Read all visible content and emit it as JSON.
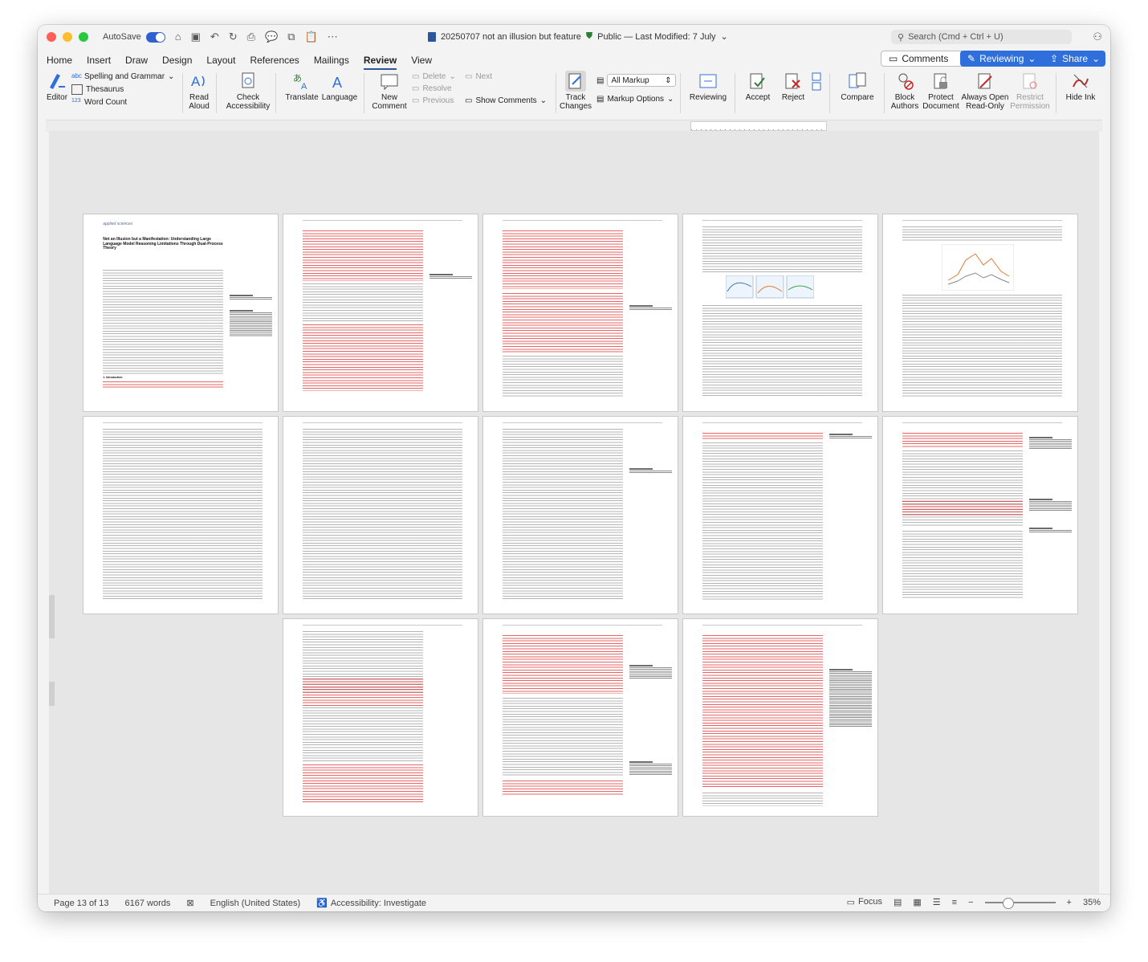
{
  "window": {
    "autosave_label": "AutoSave",
    "doc_title": "20250707 not an illusion but feature",
    "sensitivity": "Public — Last Modified: 7 July",
    "search_placeholder": "Search (Cmd + Ctrl + U)"
  },
  "tabs": [
    "Home",
    "Insert",
    "Draw",
    "Design",
    "Layout",
    "References",
    "Mailings",
    "Review",
    "View"
  ],
  "active_tab": "Review",
  "top_buttons": {
    "comments": "Comments",
    "reviewing": "Reviewing",
    "share": "Share"
  },
  "ribbon": {
    "editor": "Editor",
    "spelling": "Spelling and Grammar",
    "thesaurus": "Thesaurus",
    "word_count": "Word Count",
    "read_aloud_1": "Read",
    "read_aloud_2": "Aloud",
    "check_acc_1": "Check",
    "check_acc_2": "Accessibility",
    "translate": "Translate",
    "language": "Language",
    "new_comment_1": "New",
    "new_comment_2": "Comment",
    "delete": "Delete",
    "resolve": "Resolve",
    "previous": "Previous",
    "next": "Next",
    "show_comments": "Show Comments",
    "track_changes_1": "Track",
    "track_changes_2": "Changes",
    "markup_select": "All Markup",
    "markup_options": "Markup Options",
    "reviewing_pane": "Reviewing",
    "accept": "Accept",
    "reject": "Reject",
    "compare": "Compare",
    "block_authors_1": "Block",
    "block_authors_2": "Authors",
    "protect_1": "Protect",
    "protect_2": "Document",
    "always_open_1": "Always Open",
    "always_open_2": "Read-Only",
    "restrict_1": "Restrict",
    "restrict_2": "Permission",
    "hide_ink": "Hide Ink"
  },
  "status": {
    "page": "Page 13 of 13",
    "words": "6167 words",
    "language": "English (United States)",
    "accessibility": "Accessibility: Investigate",
    "focus": "Focus",
    "zoom": "35%"
  },
  "colors": {
    "accent": "#2f6fdb",
    "track_red": "#dc2828"
  },
  "first_page": {
    "journal": "applied sciences",
    "title": "Not an Illusion but a Manifestation: Understanding Large Language Model Reasoning Limitations Through Dual-Process Theory",
    "section": "1. Introduction"
  }
}
